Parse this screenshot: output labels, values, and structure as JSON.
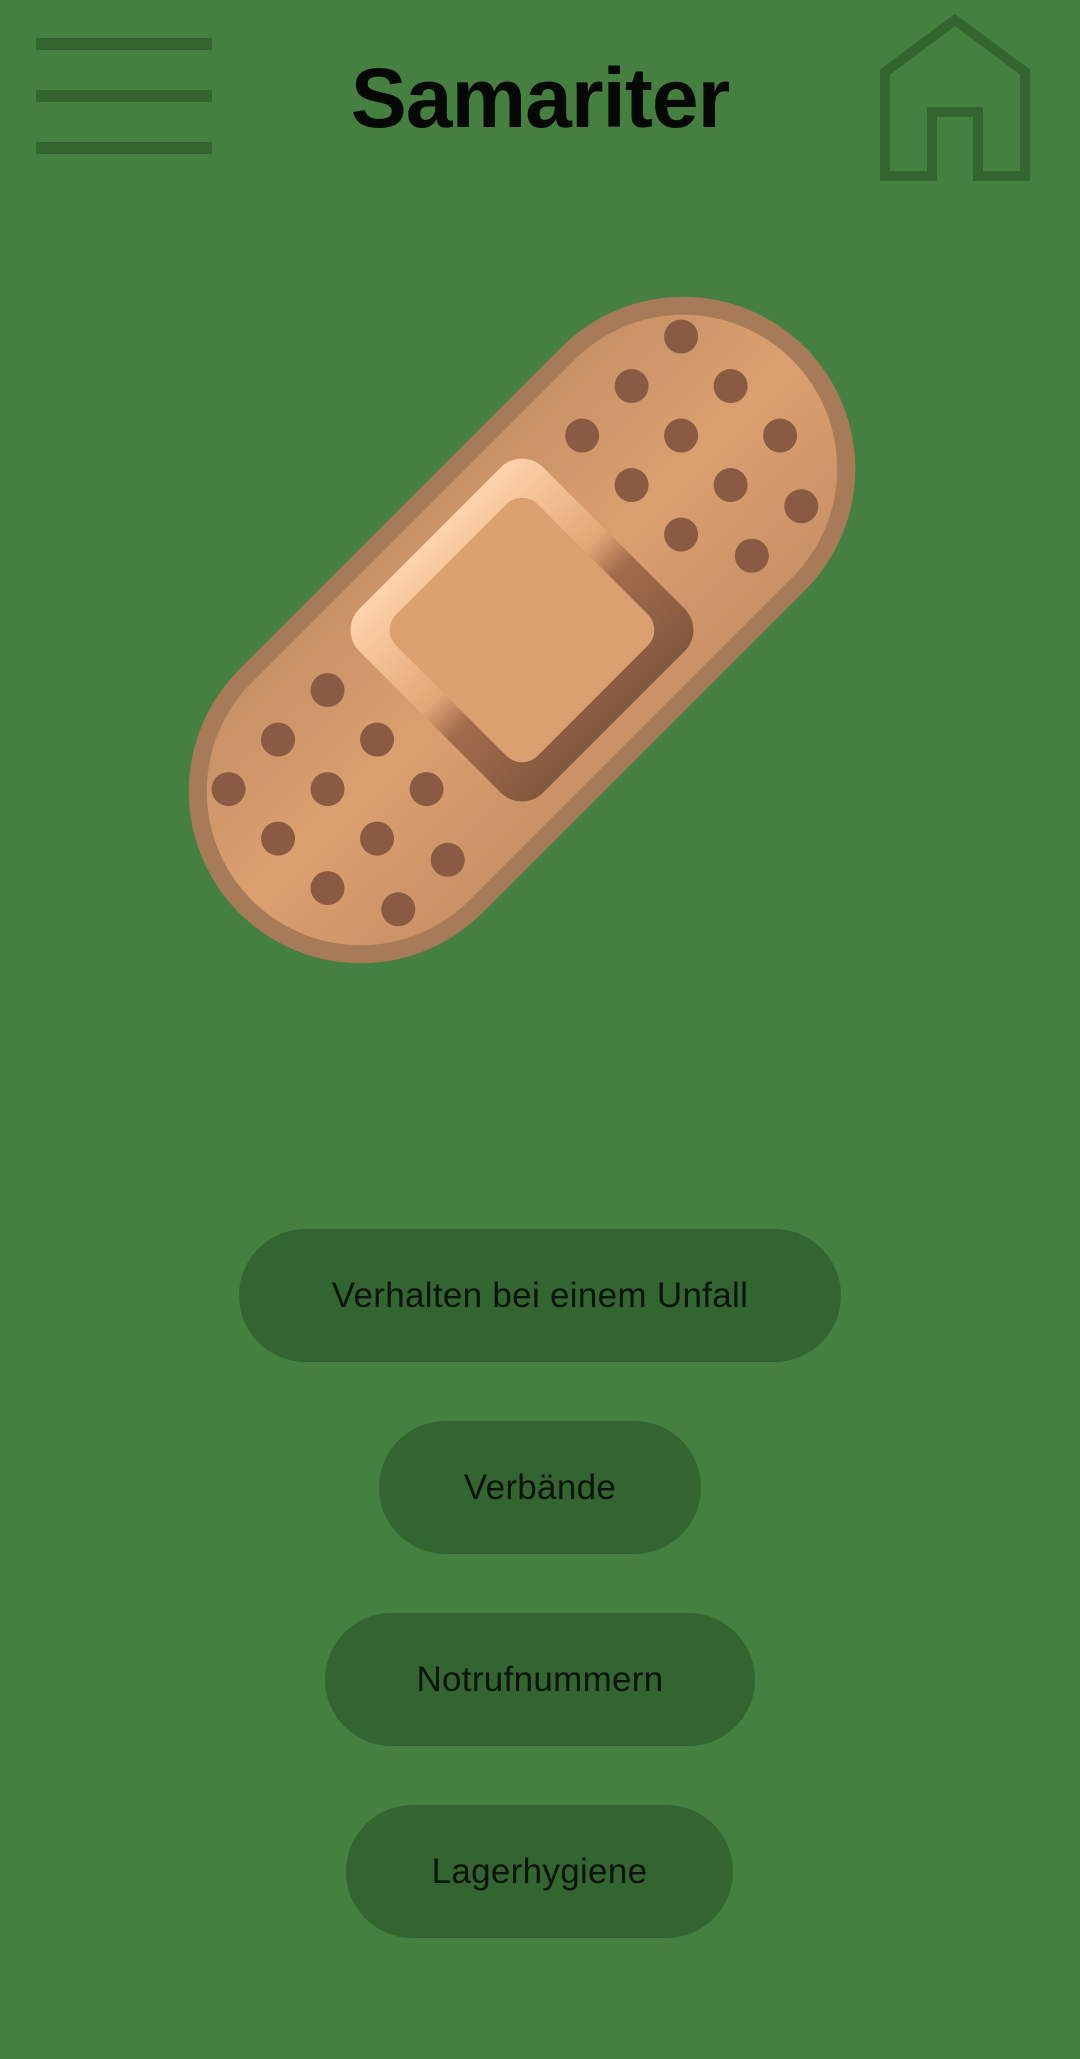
{
  "header": {
    "title": "Samariter",
    "menu_icon": "hamburger-menu-icon",
    "home_icon": "home-icon"
  },
  "hero": {
    "icon": "adhesive-bandage-icon"
  },
  "buttons": [
    {
      "label": "Verhalten bei einem Unfall"
    },
    {
      "label": "Verbände"
    },
    {
      "label": "Notrufnummern"
    },
    {
      "label": "Lagerhygiene"
    }
  ],
  "colors": {
    "background": "#458041",
    "button": "#32652f",
    "icon_dark_green": "#33652f",
    "bandage": "#d49a6a",
    "bandage_border": "#a87955",
    "bandage_holes": "#8a5a42"
  }
}
